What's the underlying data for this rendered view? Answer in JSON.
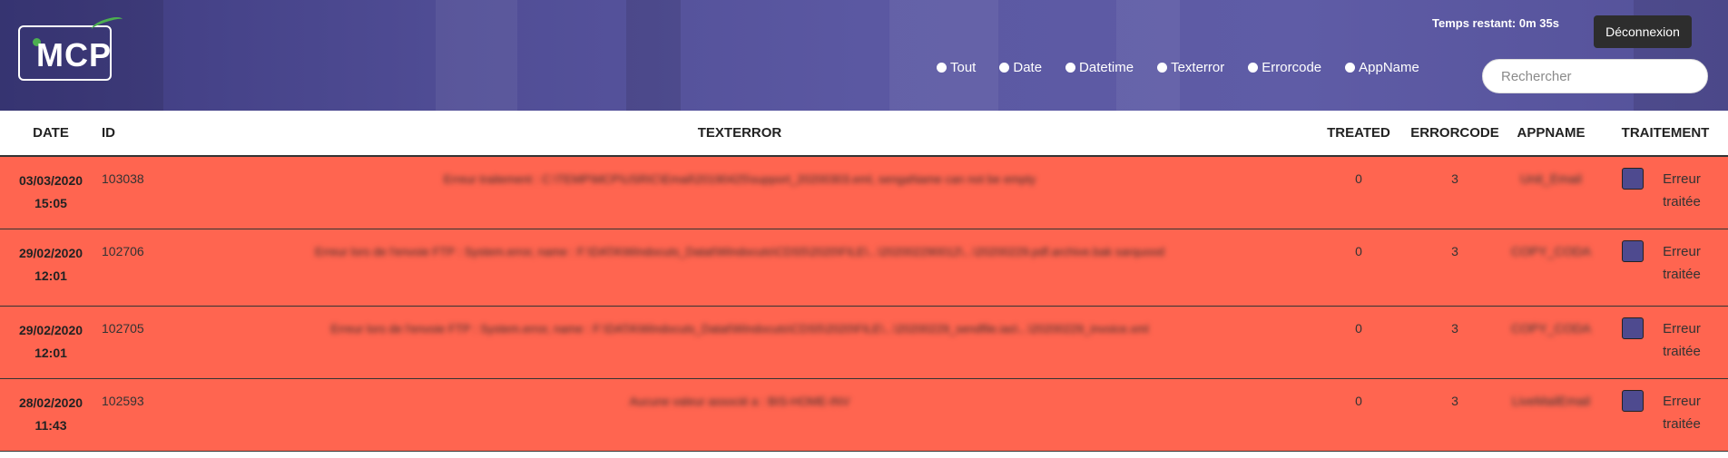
{
  "header": {
    "logo_text": "MCP",
    "timer": "Temps restant: 0m 35s",
    "logout_label": "Déconnexion",
    "filters": [
      "Tout",
      "Date",
      "Datetime",
      "Texterror",
      "Errorcode",
      "AppName"
    ],
    "search_placeholder": "Rechercher"
  },
  "table": {
    "columns": [
      "DATE",
      "ID",
      "TEXTERROR",
      "TREATED",
      "ERRORCODE",
      "APPNAME",
      "TRAITEMENT"
    ],
    "treat_label": "Erreur traitée",
    "rows": [
      {
        "date": "03/03/2020",
        "time": "15:05",
        "id": "103038",
        "text": "Erreur traitement : C:\\TEMP\\MCP\\USRIC\\Email\\20190425\\support_20200303.eml, sengaName can not be empty",
        "treated": "0",
        "errorcode": "3",
        "appname": "Unit_Email"
      },
      {
        "date": "29/02/2020",
        "time": "12:01",
        "id": "102706",
        "text": "Erreur lors de l'envoie FTP : System.error, name : F:\\DATA\\Windocuts_Datat\\Windocuts\\CDS5\\2020\\FILE\\...\\202002290012\\...\\20200229.pdf.archive.bak sarquood",
        "treated": "0",
        "errorcode": "3",
        "appname": "COPY_CODA"
      },
      {
        "date": "29/02/2020",
        "time": "12:01",
        "id": "102705",
        "text": "Erreur lors de l'envoie FTP : System.error, name : F:\\DATA\\Windocuts_Datat\\Windocuts\\CDS5\\2020\\FILE\\...\\20200229_sendfile.ias\\...\\20200229_invoice.xml",
        "treated": "0",
        "errorcode": "3",
        "appname": "COPY_CODA"
      },
      {
        "date": "28/02/2020",
        "time": "11:43",
        "id": "102593",
        "text": "Aucune valeur associé a : BIS-HOME-INV",
        "treated": "0",
        "errorcode": "3",
        "appname": "LiveMailEmail"
      }
    ]
  }
}
